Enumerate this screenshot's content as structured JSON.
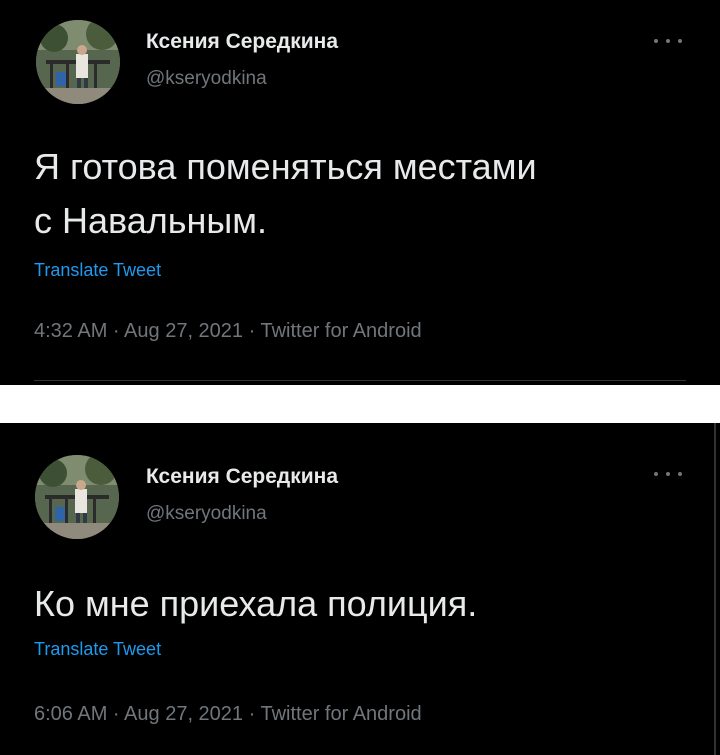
{
  "tweets": [
    {
      "author_name": "Ксения Середкина",
      "handle": "@kseryodkina",
      "text": "Я готова поменяться местами\nс Навальным.",
      "translate_label": "Translate Tweet",
      "meta": "4:32 AM · Aug 27, 2021 · Twitter for Android"
    },
    {
      "author_name": "Ксения Середкина",
      "handle": "@kseryodkina",
      "text": "Ко мне приехала полиция.",
      "translate_label": "Translate Tweet",
      "meta": "6:06 AM · Aug 27, 2021 · Twitter for Android"
    }
  ],
  "colors": {
    "background": "#000000",
    "text": "#e7e9ea",
    "secondary": "#71767b",
    "accent": "#1d9bf0",
    "separator": "#ffffff"
  },
  "icons": {
    "more": "more-options-icon"
  }
}
